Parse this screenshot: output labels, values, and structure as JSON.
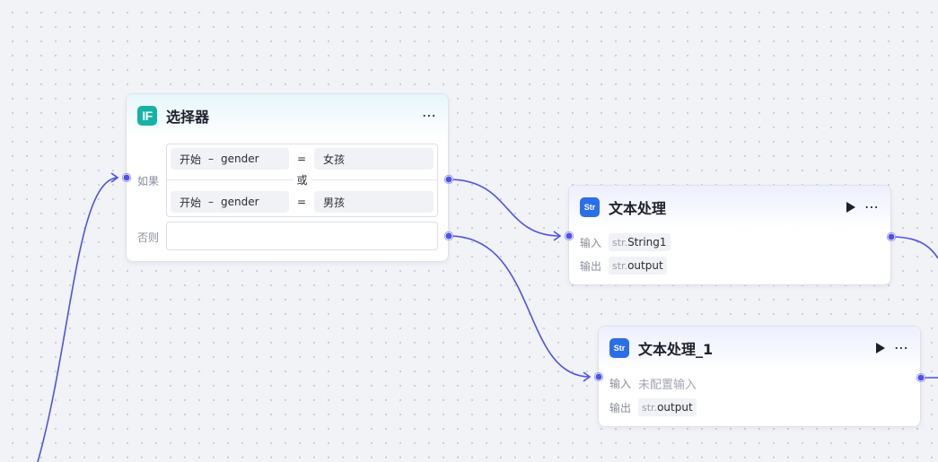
{
  "colors": {
    "edge": "#4d53e8",
    "port": "#4d53e8",
    "if_icon": "#14b3a6",
    "text_icon": "#2c6ee8"
  },
  "selector_node": {
    "icon_label": "IF",
    "icon_name": "if-icon",
    "title": "选择器",
    "more": "⋯",
    "if_label": "如果",
    "else_label": "否则",
    "or_label": "或",
    "conditions": [
      {
        "source_node": "开始",
        "separator": "–",
        "variable": "gender",
        "operator": "=",
        "value": "女孩"
      },
      {
        "source_node": "开始",
        "separator": "–",
        "variable": "gender",
        "operator": "=",
        "value": "男孩"
      }
    ],
    "else_value": ""
  },
  "text_node_1": {
    "icon_label": "Str",
    "icon_name": "text-process-icon",
    "title": "文本处理",
    "more": "⋯",
    "input_label": "输入",
    "input_type": "str.",
    "input_name": "String1",
    "output_label": "输出",
    "output_type": "str.",
    "output_name": "output"
  },
  "text_node_2": {
    "icon_label": "Str",
    "icon_name": "text-process-icon",
    "title": "文本处理_1",
    "more": "⋯",
    "input_label": "输入",
    "input_placeholder": "未配置输入",
    "output_label": "输出",
    "output_type": "str.",
    "output_name": "output"
  }
}
